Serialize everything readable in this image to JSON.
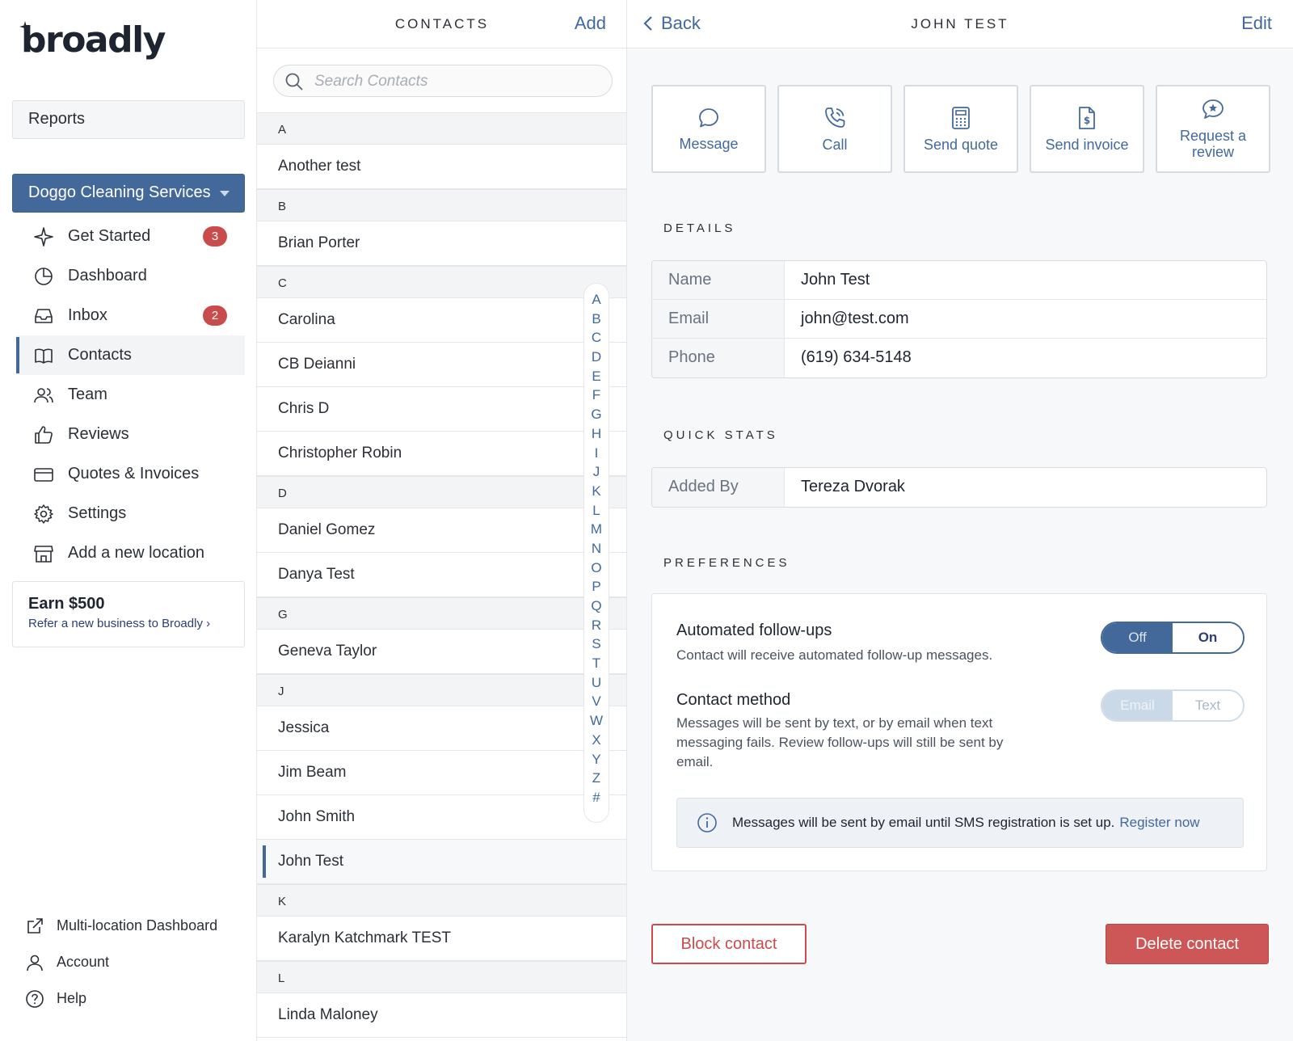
{
  "sidebar": {
    "logo": "broadly",
    "reports_label": "Reports",
    "location": "Doggo Cleaning Services",
    "nav": [
      {
        "label": "Get Started",
        "icon": "sparkle-icon",
        "badge": "3"
      },
      {
        "label": "Dashboard",
        "icon": "pie-chart-icon"
      },
      {
        "label": "Inbox",
        "icon": "inbox-icon",
        "badge": "2"
      },
      {
        "label": "Contacts",
        "icon": "book-icon",
        "active": true
      },
      {
        "label": "Team",
        "icon": "team-icon"
      },
      {
        "label": "Reviews",
        "icon": "thumbs-up-icon"
      },
      {
        "label": "Quotes & Invoices",
        "icon": "card-icon"
      },
      {
        "label": "Settings",
        "icon": "gear-icon"
      },
      {
        "label": "Add a new location",
        "icon": "storefront-icon"
      }
    ],
    "earn": {
      "title": "Earn $500",
      "link": "Refer a new business to Broadly"
    },
    "bottom": [
      {
        "label": "Multi-location Dashboard",
        "icon": "external-link-icon"
      },
      {
        "label": "Account",
        "icon": "user-icon"
      },
      {
        "label": "Help",
        "icon": "help-icon"
      }
    ]
  },
  "contacts": {
    "title": "CONTACTS",
    "add_label": "Add",
    "search_placeholder": "Search Contacts",
    "sections": [
      {
        "letter": "A",
        "items": [
          "Another test"
        ]
      },
      {
        "letter": "B",
        "items": [
          "Brian Porter"
        ]
      },
      {
        "letter": "C",
        "items": [
          "Carolina",
          "CB Deianni",
          "Chris D",
          "Christopher Robin"
        ]
      },
      {
        "letter": "D",
        "items": [
          "Daniel Gomez",
          "Danya Test"
        ]
      },
      {
        "letter": "G",
        "items": [
          "Geneva Taylor"
        ]
      },
      {
        "letter": "J",
        "items": [
          "Jessica",
          "Jim Beam",
          "John Smith",
          "John Test"
        ]
      },
      {
        "letter": "K",
        "items": [
          "Karalyn Katchmark TEST"
        ]
      },
      {
        "letter": "L",
        "items": [
          "Linda Maloney"
        ]
      }
    ],
    "selected": "John Test",
    "alphabet": [
      "A",
      "B",
      "C",
      "D",
      "E",
      "F",
      "G",
      "H",
      "I",
      "J",
      "K",
      "L",
      "M",
      "N",
      "O",
      "P",
      "Q",
      "R",
      "S",
      "T",
      "U",
      "V",
      "W",
      "X",
      "Y",
      "Z",
      "#"
    ]
  },
  "detail": {
    "back_label": "Back",
    "title": "JOHN TEST",
    "edit_label": "Edit",
    "actions": [
      {
        "label": "Message",
        "icon": "message-icon"
      },
      {
        "label": "Call",
        "icon": "phone-icon"
      },
      {
        "label": "Send quote",
        "icon": "calculator-icon"
      },
      {
        "label": "Send invoice",
        "icon": "invoice-icon"
      },
      {
        "label": "Request a review",
        "icon": "review-request-icon"
      }
    ],
    "details_label": "DETAILS",
    "details": [
      {
        "key": "Name",
        "value": "John Test"
      },
      {
        "key": "Email",
        "value": "john@test.com"
      },
      {
        "key": "Phone",
        "value": "(619) 634-5148"
      }
    ],
    "stats_label": "QUICK STATS",
    "stats": [
      {
        "key": "Added By",
        "value": "Tereza Dvorak"
      }
    ],
    "prefs_label": "PREFERENCES",
    "followups": {
      "title": "Automated follow-ups",
      "desc": "Contact will receive automated follow-up messages.",
      "off": "Off",
      "on": "On"
    },
    "method": {
      "title": "Contact method",
      "desc": "Messages will be sent by text, or by email when text messaging fails. Review follow-ups will still be sent by email.",
      "email": "Email",
      "text": "Text"
    },
    "notice": {
      "text": "Messages will be sent by email until SMS registration is set up.",
      "link": "Register now"
    },
    "block_label": "Block contact",
    "delete_label": "Delete contact"
  },
  "colors": {
    "accent": "#43699b",
    "danger": "#cd5656",
    "badge": "#c94b4b"
  }
}
